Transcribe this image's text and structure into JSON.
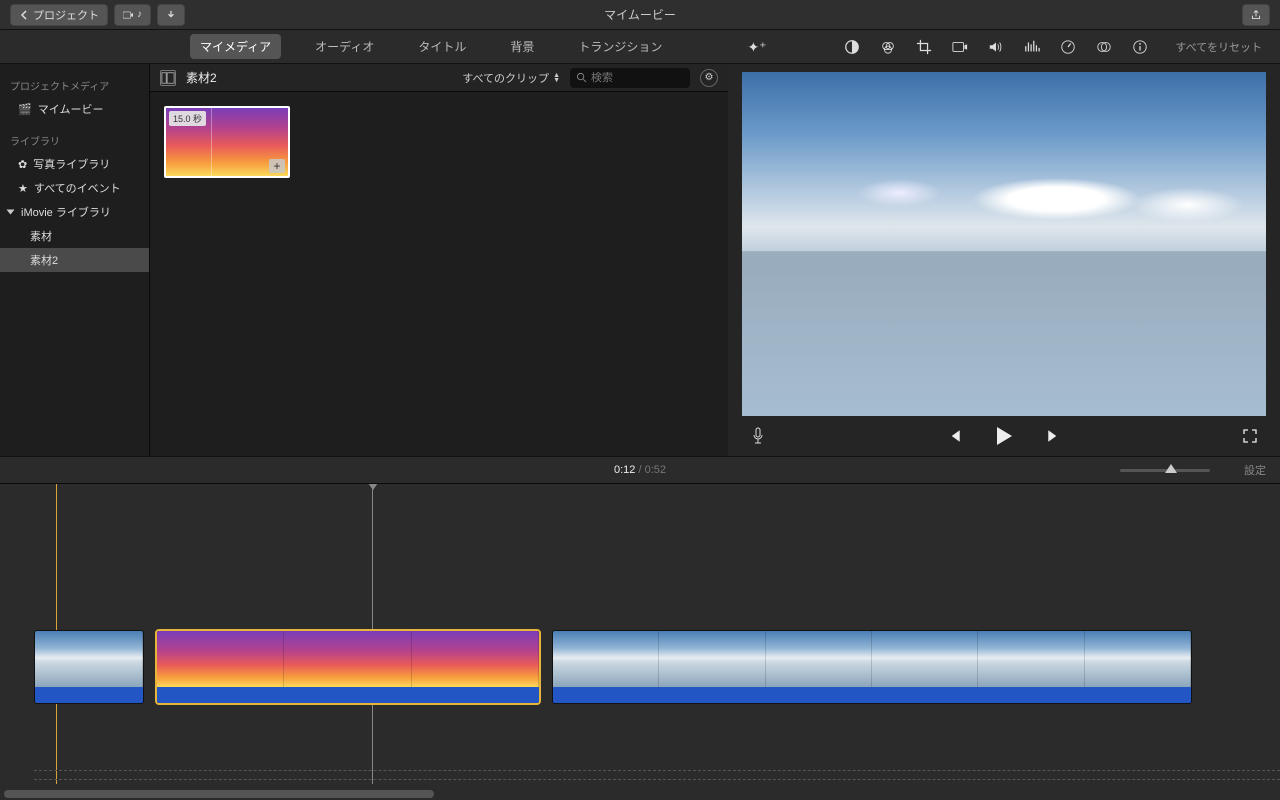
{
  "titlebar": {
    "back_label": "プロジェクト",
    "title": "マイムービー"
  },
  "tabs": {
    "my_media": "マイメディア",
    "audio": "オーディオ",
    "titles": "タイトル",
    "backgrounds": "背景",
    "transitions": "トランジション"
  },
  "adjust": {
    "reset_all": "すべてをリセット"
  },
  "sidebar": {
    "project_media_hdr": "プロジェクトメディア",
    "my_movie": "マイムービー",
    "library_hdr": "ライブラリ",
    "photo_library": "写真ライブラリ",
    "all_events": "すべてのイベント",
    "imovie_library": "iMovie ライブラリ",
    "sozai1": "素材",
    "sozai2": "素材2"
  },
  "browser": {
    "title": "素材2",
    "filter_label": "すべてのクリップ",
    "search_placeholder": "検索",
    "thumb_duration": "15.0 秒"
  },
  "timeline": {
    "current": "0:12",
    "total": "0:52",
    "settings": "設定"
  }
}
